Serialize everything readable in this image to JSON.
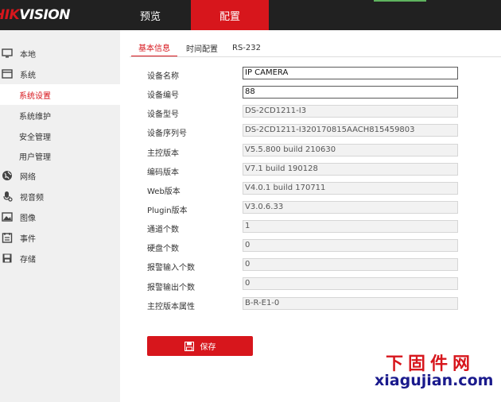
{
  "header": {
    "logo_text": "HIKVISION",
    "nav": [
      {
        "label": "预览"
      },
      {
        "label": "配置"
      }
    ]
  },
  "sidebar": {
    "items": [
      {
        "label": "本地",
        "icon": "monitor-icon"
      },
      {
        "label": "系统",
        "icon": "system-icon"
      },
      {
        "label": "系统设置"
      },
      {
        "label": "系统维护"
      },
      {
        "label": "安全管理"
      },
      {
        "label": "用户管理"
      },
      {
        "label": "网络",
        "icon": "globe-icon"
      },
      {
        "label": "视音频",
        "icon": "microphone-icon"
      },
      {
        "label": "图像",
        "icon": "image-icon"
      },
      {
        "label": "事件",
        "icon": "calendar-icon"
      },
      {
        "label": "存储",
        "icon": "disk-icon"
      }
    ],
    "active_item": "系统设置"
  },
  "tabs": [
    {
      "label": "基本信息"
    },
    {
      "label": "时间配置"
    },
    {
      "label": "RS-232"
    }
  ],
  "active_tab": "基本信息",
  "form": {
    "fields": [
      {
        "label": "设备名称",
        "value": "IP CAMERA"
      },
      {
        "label": "设备编号",
        "value": "88"
      },
      {
        "label": "设备型号",
        "value": "DS-2CD1211-I3"
      },
      {
        "label": "设备序列号",
        "value": "DS-2CD1211-I320170815AACH815459803"
      },
      {
        "label": "主控版本",
        "value": "V5.5.800 build 210630"
      },
      {
        "label": "编码版本",
        "value": "V7.1 build 190128"
      },
      {
        "label": "Web版本",
        "value": "V4.0.1 build 170711"
      },
      {
        "label": "Plugin版本",
        "value": "V3.0.6.33"
      },
      {
        "label": "通道个数",
        "value": "1"
      },
      {
        "label": "硬盘个数",
        "value": "0"
      },
      {
        "label": "报警输入个数",
        "value": "0"
      },
      {
        "label": "报警输出个数",
        "value": "0"
      },
      {
        "label": "主控版本属性",
        "value": "B-R-E1-0"
      }
    ],
    "save_label": "保存"
  },
  "watermark": {
    "line1": "下固件网",
    "line2": "xiagujian.com"
  },
  "colors": {
    "accent": "#d7161c",
    "topbar": "#212121",
    "sidebar": "#f0f0f0"
  }
}
